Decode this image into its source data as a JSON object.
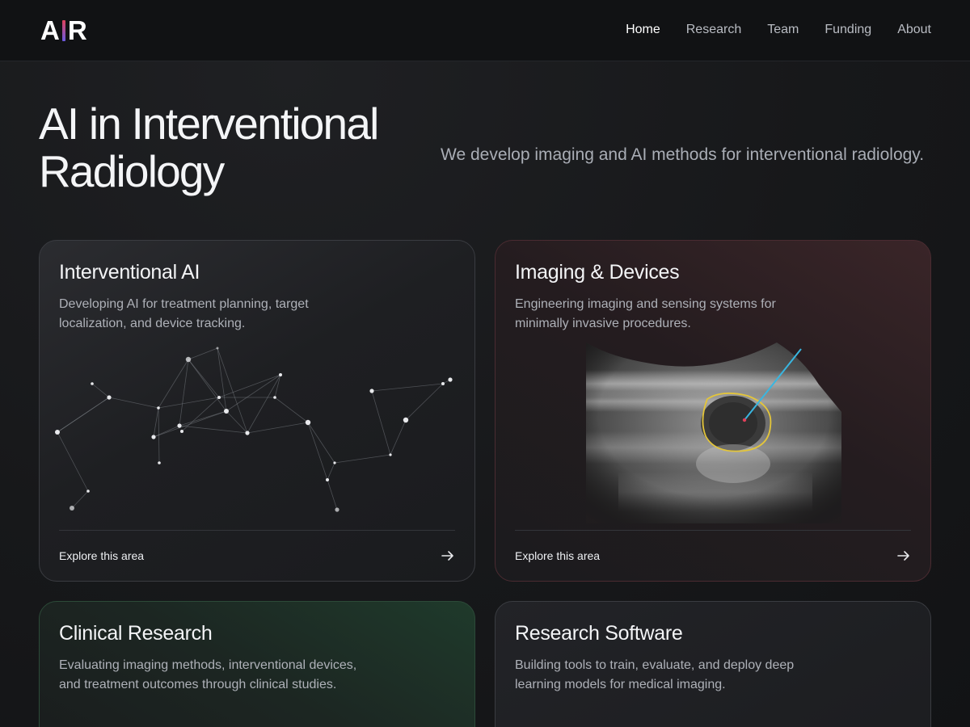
{
  "header": {
    "logo": {
      "left": "A",
      "right": "R"
    },
    "nav": [
      {
        "label": "Home",
        "active": true
      },
      {
        "label": "Research",
        "active": false
      },
      {
        "label": "Team",
        "active": false
      },
      {
        "label": "Funding",
        "active": false
      },
      {
        "label": "About",
        "active": false
      }
    ]
  },
  "hero": {
    "title": "AI in Interventional Radiology",
    "subtitle": "We develop imaging and AI methods for interventional radiology."
  },
  "cards": [
    {
      "title": "Interventional AI",
      "description": "Developing AI for treatment planning, target localization, and device tracking.",
      "link": "Explore this area",
      "illustration": "node-network-graphic"
    },
    {
      "title": "Imaging & Devices",
      "description": "Engineering imaging and sensing systems for minimally invasive procedures.",
      "link": "Explore this area",
      "illustration": "ultrasound-image-with-needle"
    },
    {
      "title": "Clinical Research",
      "description": "Evaluating imaging methods, interventional devices, and treatment outcomes through clinical studies."
    },
    {
      "title": "Research Software",
      "description": "Building tools to train, evaluate, and deploy deep learning models for medical imaging."
    }
  ],
  "colors": {
    "background": "#161719",
    "accent_red": "#e0405a",
    "accent_violet": "#6a5ae0",
    "contour_yellow": "#e3c53a",
    "needle_cyan": "#39b6e0"
  }
}
